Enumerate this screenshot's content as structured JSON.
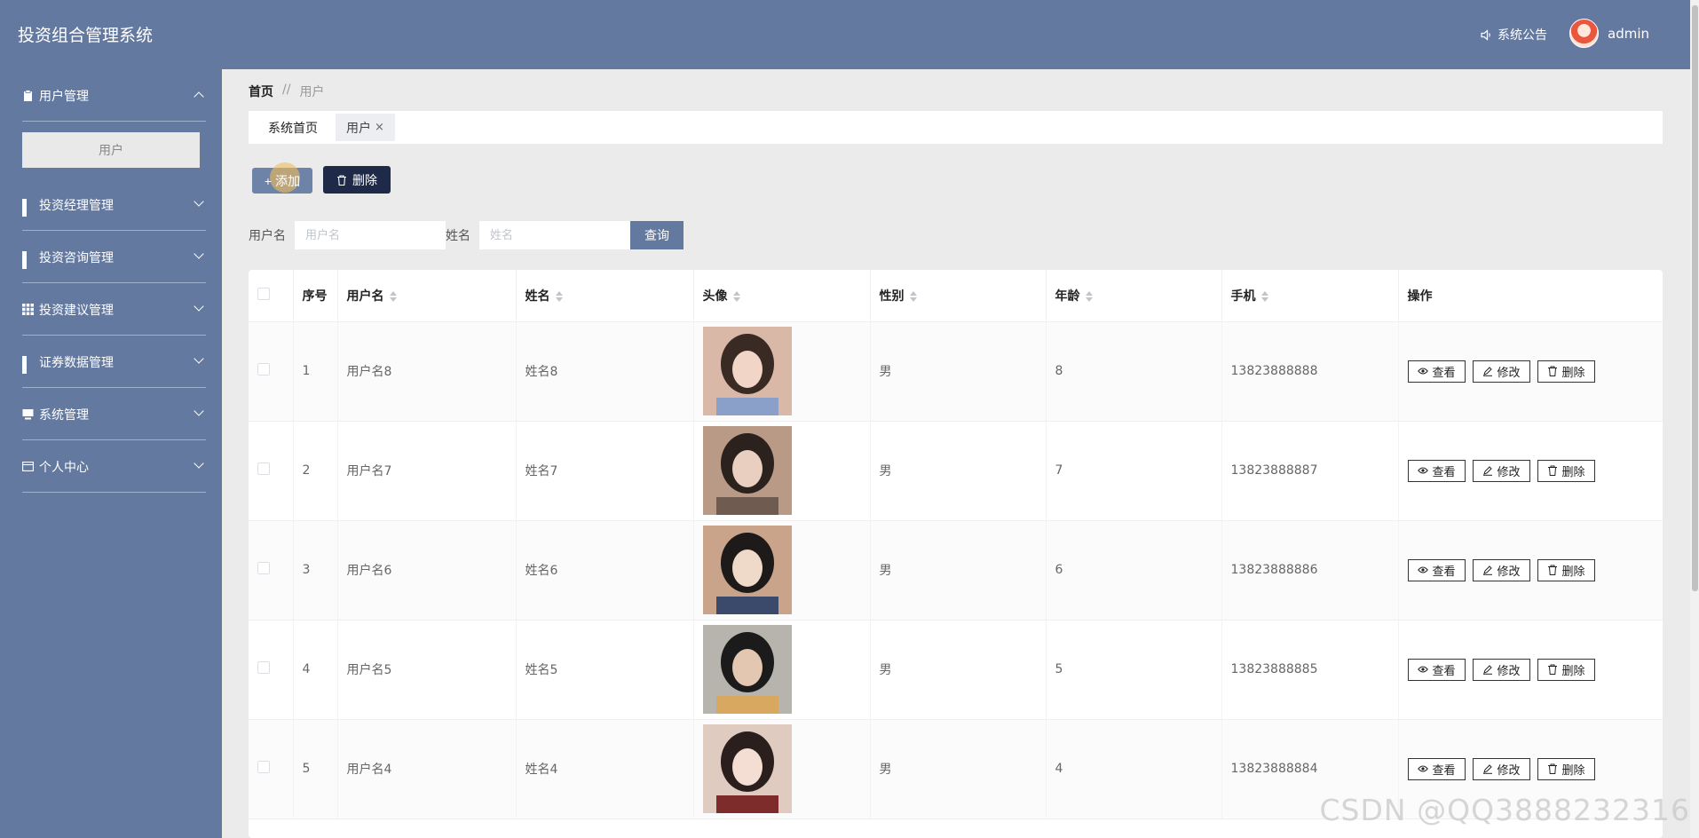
{
  "app": {
    "title": "投资组合管理系统"
  },
  "header": {
    "notice": "系统公告",
    "username": "admin"
  },
  "sidebar": {
    "items": [
      {
        "label": "用户管理",
        "expanded": true,
        "sub": [
          {
            "label": "用户"
          }
        ]
      },
      {
        "label": "投资经理管理"
      },
      {
        "label": "投资咨询管理"
      },
      {
        "label": "投资建议管理"
      },
      {
        "label": "证券数据管理"
      },
      {
        "label": "系统管理"
      },
      {
        "label": "个人中心"
      }
    ]
  },
  "breadcrumb": {
    "home": "首页",
    "separator": "//",
    "current": "用户"
  },
  "tabs": [
    {
      "label": "系统首页"
    },
    {
      "label": "用户",
      "close": "×"
    }
  ],
  "toolbar": {
    "add_label": "添加",
    "delete_label": "删除"
  },
  "search": {
    "username_label": "用户名",
    "username_placeholder": "用户名",
    "name_label": "姓名",
    "name_placeholder": "姓名",
    "query_label": "查询"
  },
  "table": {
    "columns": [
      "序号",
      "用户名",
      "姓名",
      "头像",
      "性别",
      "年龄",
      "手机",
      "操作"
    ],
    "rows": [
      {
        "index": "1",
        "username": "用户名8",
        "name": "姓名8",
        "gender": "男",
        "age": "8",
        "phone": "13823888888"
      },
      {
        "index": "2",
        "username": "用户名7",
        "name": "姓名7",
        "gender": "男",
        "age": "7",
        "phone": "13823888887"
      },
      {
        "index": "3",
        "username": "用户名6",
        "name": "姓名6",
        "gender": "男",
        "age": "6",
        "phone": "13823888886"
      },
      {
        "index": "4",
        "username": "用户名5",
        "name": "姓名5",
        "gender": "男",
        "age": "5",
        "phone": "13823888885"
      },
      {
        "index": "5",
        "username": "用户名4",
        "name": "姓名4",
        "gender": "男",
        "age": "4",
        "phone": "13823888884"
      }
    ],
    "actions": {
      "view": "查看",
      "edit": "修改",
      "delete": "删除"
    }
  },
  "watermark": "CSDN @QQ3888232316",
  "colors": {
    "header": "#6479a0",
    "primary_button": "#6479a0",
    "dark_button": "#1e2a48"
  }
}
